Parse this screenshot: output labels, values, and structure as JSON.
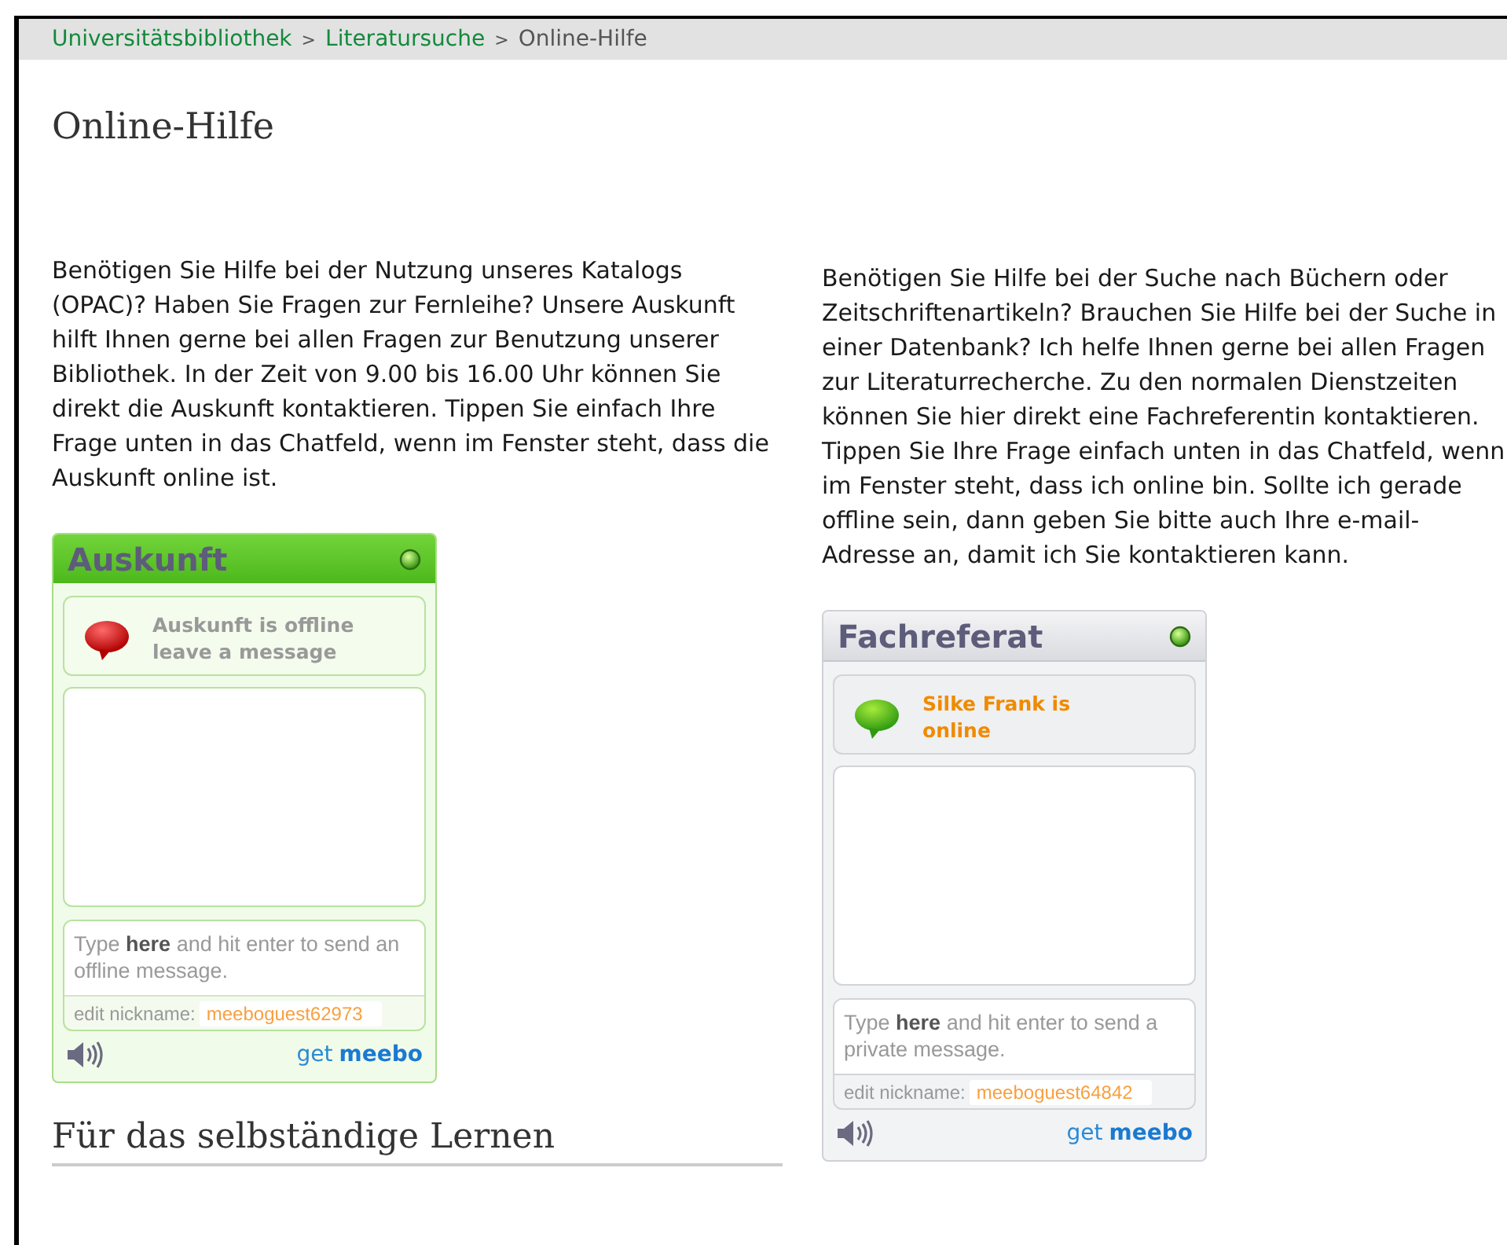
{
  "breadcrumb": [
    {
      "label": "Universitätsbibliothek",
      "link": true
    },
    {
      "label": "Literatursuche",
      "link": true
    },
    {
      "label": "Online-Hilfe",
      "link": false
    }
  ],
  "separator": ">",
  "title": "Online-Hilfe",
  "columns": [
    {
      "text": "Benötigen Sie Hilfe bei der Nutzung unseres Katalogs (OPAC)? Haben Sie Fragen zur Fernleihe? Unsere Auskunft hilft Ihnen gerne bei allen Fragen zur Benutzung unserer Bibliothek. In der Zeit von 9.00 bis 16.00 Uhr können Sie direkt die Auskunft kontaktieren. Tippen Sie einfach Ihre Frage unten in das Chatfeld, wenn im Fenster steht, dass die Auskunft online ist.",
      "widget": {
        "kind": "green",
        "title": "Auskunft",
        "online": false,
        "status": "Auskunft is offline leave a message",
        "input_hint": "Type **here** and hit enter to send an offline message.",
        "nickname_label": "edit nickname:",
        "nickname": "meeboguest62973",
        "logo_get": "get",
        "logo_brand": "meebo"
      },
      "heading": "Für das selbständige Lernen"
    },
    {
      "text": "Benötigen Sie Hilfe bei der Suche nach Büchern oder Zeitschriftenartikeln? Brauchen Sie Hilfe bei der Suche in einer Datenbank? Ich helfe Ihnen gerne bei allen Fragen zur Literaturrecherche. Zu den normalen Dienstzeiten können Sie hier direkt eine Fachreferentin kontaktieren. Tippen Sie Ihre Frage einfach unten in das Chatfeld, wenn im Fenster steht, dass ich online bin. Sollte ich gerade offline sein, dann geben Sie bitte auch Ihre e-mail-Adresse an, damit ich Sie kontaktieren kann.",
      "widget": {
        "kind": "gray",
        "title": "Fachreferat",
        "online": true,
        "status": "Silke Frank is online",
        "input_hint": "Type **here** and hit enter to send a private message.",
        "nickname_label": "edit nickname:",
        "nickname": "meeboguest64842",
        "logo_get": "get",
        "logo_brand": "meebo"
      }
    }
  ]
}
